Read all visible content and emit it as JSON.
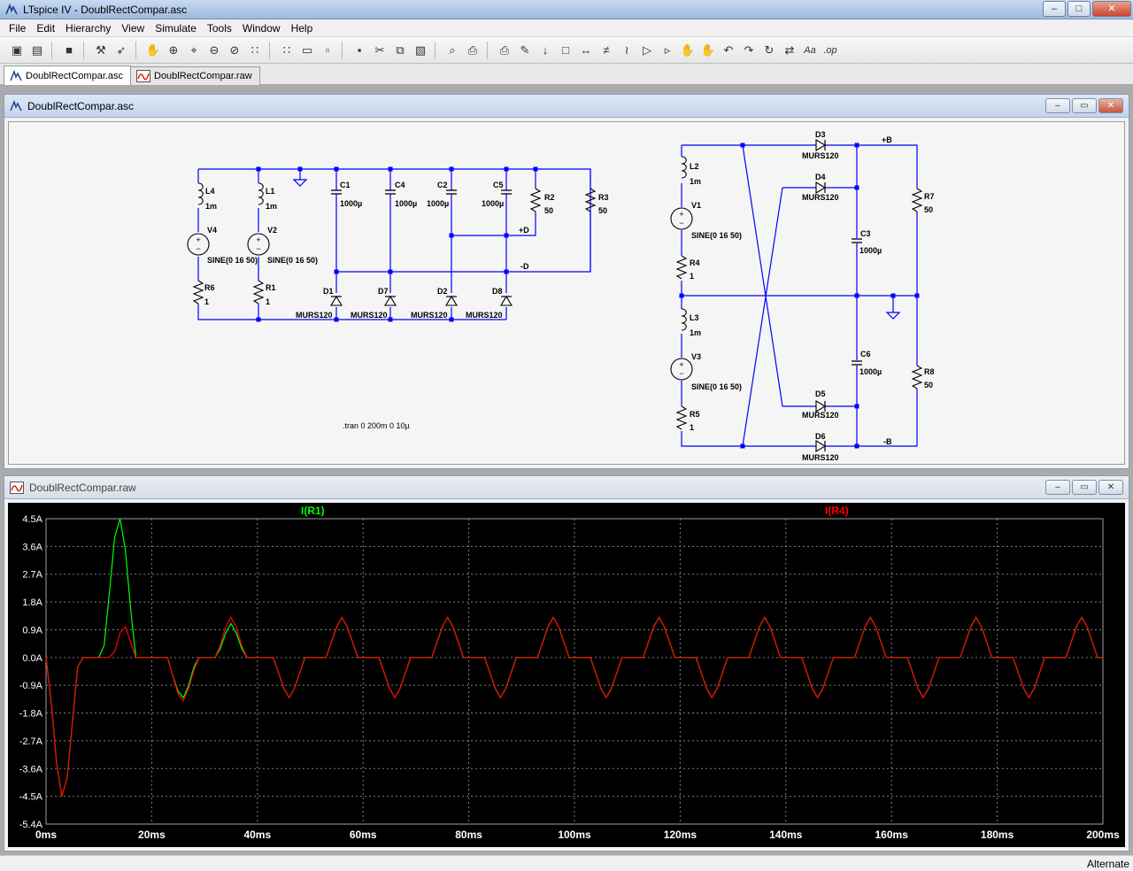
{
  "window": {
    "title": "LTspice IV - DoublRectCompar.asc",
    "minimize": "–",
    "maximize": "□",
    "close": "✕"
  },
  "menu": [
    "File",
    "Edit",
    "Hierarchy",
    "View",
    "Simulate",
    "Tools",
    "Window",
    "Help"
  ],
  "toolbar": {
    "icons": [
      "new-schematic-icon",
      "open-icon",
      "save-icon",
      "control-panel-icon",
      "run-icon",
      "halt-icon",
      "zoom-in-icon",
      "zoom-pan-icon",
      "zoom-out-icon",
      "zoom-fit-icon",
      "autorange-icon",
      "grid-icon",
      "tile-horizontal-icon",
      "cascade-icon",
      "tile-vertical-icon",
      "cut-icon",
      "copy-icon",
      "paste-icon",
      "find-icon",
      "print-icon",
      "print-preview-icon",
      "wire-icon",
      "ground-icon",
      "label-icon",
      "resistor-icon",
      "capacitor-icon",
      "inductor-icon",
      "diode-icon",
      "component-icon",
      "move-icon",
      "drag-icon",
      "undo-icon",
      "redo-icon",
      "rotate-icon",
      "mirror-icon",
      "text-icon",
      "spice-directive-icon"
    ],
    "glyphs": [
      "▣",
      "▤",
      "■",
      "⚒",
      "➶",
      "✋",
      "⊕",
      "⌖",
      "⊖",
      "⊘",
      "∷",
      "∷",
      "▭",
      "▫",
      "▪",
      "✂",
      "⧉",
      "▧",
      "⌕",
      "⎙",
      "⎙",
      "✎",
      "↓",
      "□",
      "↔",
      "≠",
      "≀",
      "▷",
      "▹",
      "✋",
      "✋",
      "↶",
      "↷",
      "↻",
      "⇄",
      "Aa",
      ".op"
    ]
  },
  "tabs": [
    {
      "label": "DoublRectCompar.asc",
      "icon": "schematic-icon",
      "active": true
    },
    {
      "label": "DoublRectCompar.raw",
      "icon": "waveform-icon",
      "active": false
    }
  ],
  "schematic_window": {
    "title": "DoublRectCompar.asc",
    "directive": ".tran 0 200m 0 10µ",
    "left_circuit": {
      "labels": {
        "L4": "L4",
        "L4v": "1m",
        "L1": "L1",
        "L1v": "1m",
        "V4": "V4",
        "V4v": "SINE(0 16 50)",
        "V2": "V2",
        "V2v": "SINE(0 16 50)",
        "R6": "R6",
        "R6v": "1",
        "R1": "R1",
        "R1v": "1",
        "C1": "C1",
        "C1v": "1000µ",
        "C4": "C4",
        "C4v": "1000µ",
        "C2": "C2",
        "C2v": "1000µ",
        "C5": "C5",
        "C5v": "1000µ",
        "R2": "R2",
        "R2v": "50",
        "R3": "R3",
        "R3v": "50",
        "pD": "+D",
        "mD": "-D",
        "D1": "D1",
        "D7": "D7",
        "D2": "D2",
        "D8": "D8",
        "D1v": "MURS120",
        "D7v": "MURS120",
        "D2v": "MURS120",
        "D8v": "MURS120"
      }
    },
    "right_circuit": {
      "labels": {
        "L2": "L2",
        "L2v": "1m",
        "V1": "V1",
        "V1v": "SINE(0 16 50)",
        "R4": "R4",
        "R4v": "1",
        "L3": "L3",
        "L3v": "1m",
        "V3": "V3",
        "V3v": "SINE(0 16 50)",
        "R5": "R5",
        "R5v": "1",
        "D3": "D3",
        "D3v": "MURS120",
        "D4": "D4",
        "D4v": "MURS120",
        "D5": "D5",
        "D5v": "MURS120",
        "D6": "D6",
        "D6v": "MURS120",
        "C3": "C3",
        "C3v": "1000µ",
        "C6": "C6",
        "C6v": "1000µ",
        "R7": "R7",
        "R7v": "50",
        "R8": "R8",
        "R8v": "50",
        "pB": "+B",
        "mB": "-B"
      }
    }
  },
  "waveform_window": {
    "title": "DoublRectCompar.raw"
  },
  "colors": {
    "trace1": "#00ff00",
    "trace2": "#ff0000",
    "grid": "#808080",
    "axis_text": "#ffffff",
    "wire": "#0000ff"
  },
  "chart_data": {
    "type": "line",
    "title": "",
    "xlabel": "",
    "ylabel": "",
    "xlim": [
      0,
      200
    ],
    "ylim": [
      -5.4,
      4.5
    ],
    "x_unit": "ms",
    "y_unit": "A",
    "x_ticks": [
      "0ms",
      "20ms",
      "40ms",
      "60ms",
      "80ms",
      "100ms",
      "120ms",
      "140ms",
      "160ms",
      "180ms",
      "200ms"
    ],
    "y_ticks": [
      "4.5A",
      "3.6A",
      "2.7A",
      "1.8A",
      "0.9A",
      "0.0A",
      "-0.9A",
      "-1.8A",
      "-2.7A",
      "-3.6A",
      "-4.5A",
      "-5.4A"
    ],
    "grid": true,
    "series": [
      {
        "name": "I(R1)",
        "color": "#00ff00",
        "x": [
          0,
          1,
          2,
          3,
          4,
          5,
          6,
          7,
          8,
          9,
          10,
          11,
          12,
          13,
          14,
          15,
          16,
          17,
          20,
          23,
          24,
          25,
          26,
          27,
          28,
          29,
          32,
          33,
          34,
          35,
          36,
          37,
          38,
          39,
          43,
          44,
          45,
          46,
          47,
          48,
          49,
          53,
          54,
          55,
          56,
          57,
          58,
          59,
          63,
          64,
          65,
          66,
          67,
          68,
          69,
          73,
          74,
          75,
          76,
          77,
          78,
          79,
          83,
          84,
          85,
          86,
          87,
          88,
          89,
          93,
          94,
          95,
          96,
          97,
          98,
          99,
          103,
          104,
          105,
          106,
          107,
          108,
          109,
          113,
          114,
          115,
          116,
          117,
          118,
          119,
          123,
          124,
          125,
          126,
          127,
          128,
          129,
          133,
          134,
          135,
          136,
          137,
          138,
          139,
          143,
          144,
          145,
          146,
          147,
          148,
          149,
          153,
          154,
          155,
          156,
          157,
          158,
          159,
          163,
          164,
          165,
          166,
          167,
          168,
          169,
          173,
          174,
          175,
          176,
          177,
          178,
          179,
          183,
          184,
          185,
          186,
          187,
          188,
          189,
          193,
          194,
          195,
          196,
          197,
          198,
          199,
          200
        ],
        "y": [
          0,
          -1.5,
          -3.4,
          -4.5,
          -3.9,
          -2.1,
          -0.3,
          0,
          0,
          0,
          0,
          0.4,
          2.1,
          3.9,
          4.5,
          3.5,
          1.6,
          0,
          0,
          0,
          -0.6,
          -1.1,
          -1.3,
          -0.9,
          -0.3,
          0,
          0,
          0.3,
          0.8,
          1.1,
          0.8,
          0.3,
          0,
          0,
          0,
          -0.5,
          -1.0,
          -1.3,
          -1.0,
          -0.5,
          0,
          0,
          0.5,
          1.0,
          1.3,
          1.0,
          0.5,
          0,
          0,
          -0.5,
          -1.0,
          -1.3,
          -1.0,
          -0.5,
          0,
          0,
          0.5,
          1.0,
          1.3,
          1.0,
          0.5,
          0,
          0,
          -0.5,
          -1.0,
          -1.3,
          -1.0,
          -0.5,
          0,
          0,
          0.5,
          1.0,
          1.3,
          1.0,
          0.5,
          0,
          0,
          -0.5,
          -1.0,
          -1.3,
          -1.0,
          -0.5,
          0,
          0,
          0.5,
          1.0,
          1.3,
          1.0,
          0.5,
          0,
          0,
          -0.5,
          -1.0,
          -1.3,
          -1.0,
          -0.5,
          0,
          0,
          0.5,
          1.0,
          1.3,
          1.0,
          0.5,
          0,
          0,
          -0.5,
          -1.0,
          -1.3,
          -1.0,
          -0.5,
          0,
          0,
          0.5,
          1.0,
          1.3,
          1.0,
          0.5,
          0,
          0,
          -0.5,
          -1.0,
          -1.3,
          -1.0,
          -0.5,
          0,
          0,
          0.5,
          1.0,
          1.3,
          1.0,
          0.5,
          0,
          0,
          -0.5,
          -1.0,
          -1.3,
          -1.0,
          -0.5,
          0,
          0,
          0.5,
          1.0,
          1.3,
          1.0,
          0.5,
          0,
          0
        ]
      },
      {
        "name": "I(R4)",
        "color": "#ff0000",
        "x": [
          0,
          1,
          2,
          3,
          4,
          5,
          6,
          7,
          8,
          9,
          10,
          11,
          12,
          13,
          14,
          15,
          16,
          17,
          20,
          23,
          24,
          25,
          26,
          27,
          28,
          29,
          32,
          33,
          34,
          35,
          36,
          37,
          38,
          39,
          43,
          44,
          45,
          46,
          47,
          48,
          49,
          53,
          54,
          55,
          56,
          57,
          58,
          59,
          63,
          64,
          65,
          66,
          67,
          68,
          69,
          73,
          74,
          75,
          76,
          77,
          78,
          79,
          83,
          84,
          85,
          86,
          87,
          88,
          89,
          93,
          94,
          95,
          96,
          97,
          98,
          99,
          103,
          104,
          105,
          106,
          107,
          108,
          109,
          113,
          114,
          115,
          116,
          117,
          118,
          119,
          123,
          124,
          125,
          126,
          127,
          128,
          129,
          133,
          134,
          135,
          136,
          137,
          138,
          139,
          143,
          144,
          145,
          146,
          147,
          148,
          149,
          153,
          154,
          155,
          156,
          157,
          158,
          159,
          163,
          164,
          165,
          166,
          167,
          168,
          169,
          173,
          174,
          175,
          176,
          177,
          178,
          179,
          183,
          184,
          185,
          186,
          187,
          188,
          189,
          193,
          194,
          195,
          196,
          197,
          198,
          199,
          200
        ],
        "y": [
          0,
          -1.5,
          -3.4,
          -4.5,
          -3.9,
          -2.1,
          -0.3,
          0,
          0,
          0,
          0,
          0,
          0,
          0.2,
          0.8,
          1.0,
          0.5,
          0,
          0,
          0,
          -0.6,
          -1.2,
          -1.4,
          -1.0,
          -0.4,
          0,
          0,
          0.4,
          1.0,
          1.3,
          1.0,
          0.4,
          0,
          0,
          0,
          -0.5,
          -1.0,
          -1.3,
          -1.0,
          -0.5,
          0,
          0,
          0.5,
          1.0,
          1.3,
          1.0,
          0.5,
          0,
          0,
          -0.5,
          -1.0,
          -1.3,
          -1.0,
          -0.5,
          0,
          0,
          0.5,
          1.0,
          1.3,
          1.0,
          0.5,
          0,
          0,
          -0.5,
          -1.0,
          -1.3,
          -1.0,
          -0.5,
          0,
          0,
          0.5,
          1.0,
          1.3,
          1.0,
          0.5,
          0,
          0,
          -0.5,
          -1.0,
          -1.3,
          -1.0,
          -0.5,
          0,
          0,
          0.5,
          1.0,
          1.3,
          1.0,
          0.5,
          0,
          0,
          -0.5,
          -1.0,
          -1.3,
          -1.0,
          -0.5,
          0,
          0,
          0.5,
          1.0,
          1.3,
          1.0,
          0.5,
          0,
          0,
          -0.5,
          -1.0,
          -1.3,
          -1.0,
          -0.5,
          0,
          0,
          0.5,
          1.0,
          1.3,
          1.0,
          0.5,
          0,
          0,
          -0.5,
          -1.0,
          -1.3,
          -1.0,
          -0.5,
          0,
          0,
          0.5,
          1.0,
          1.3,
          1.0,
          0.5,
          0,
          0,
          -0.5,
          -1.0,
          -1.3,
          -1.0,
          -0.5,
          0,
          0,
          0.5,
          1.0,
          1.3,
          1.0,
          0.5,
          0,
          0
        ]
      }
    ]
  },
  "status": "Alternate"
}
